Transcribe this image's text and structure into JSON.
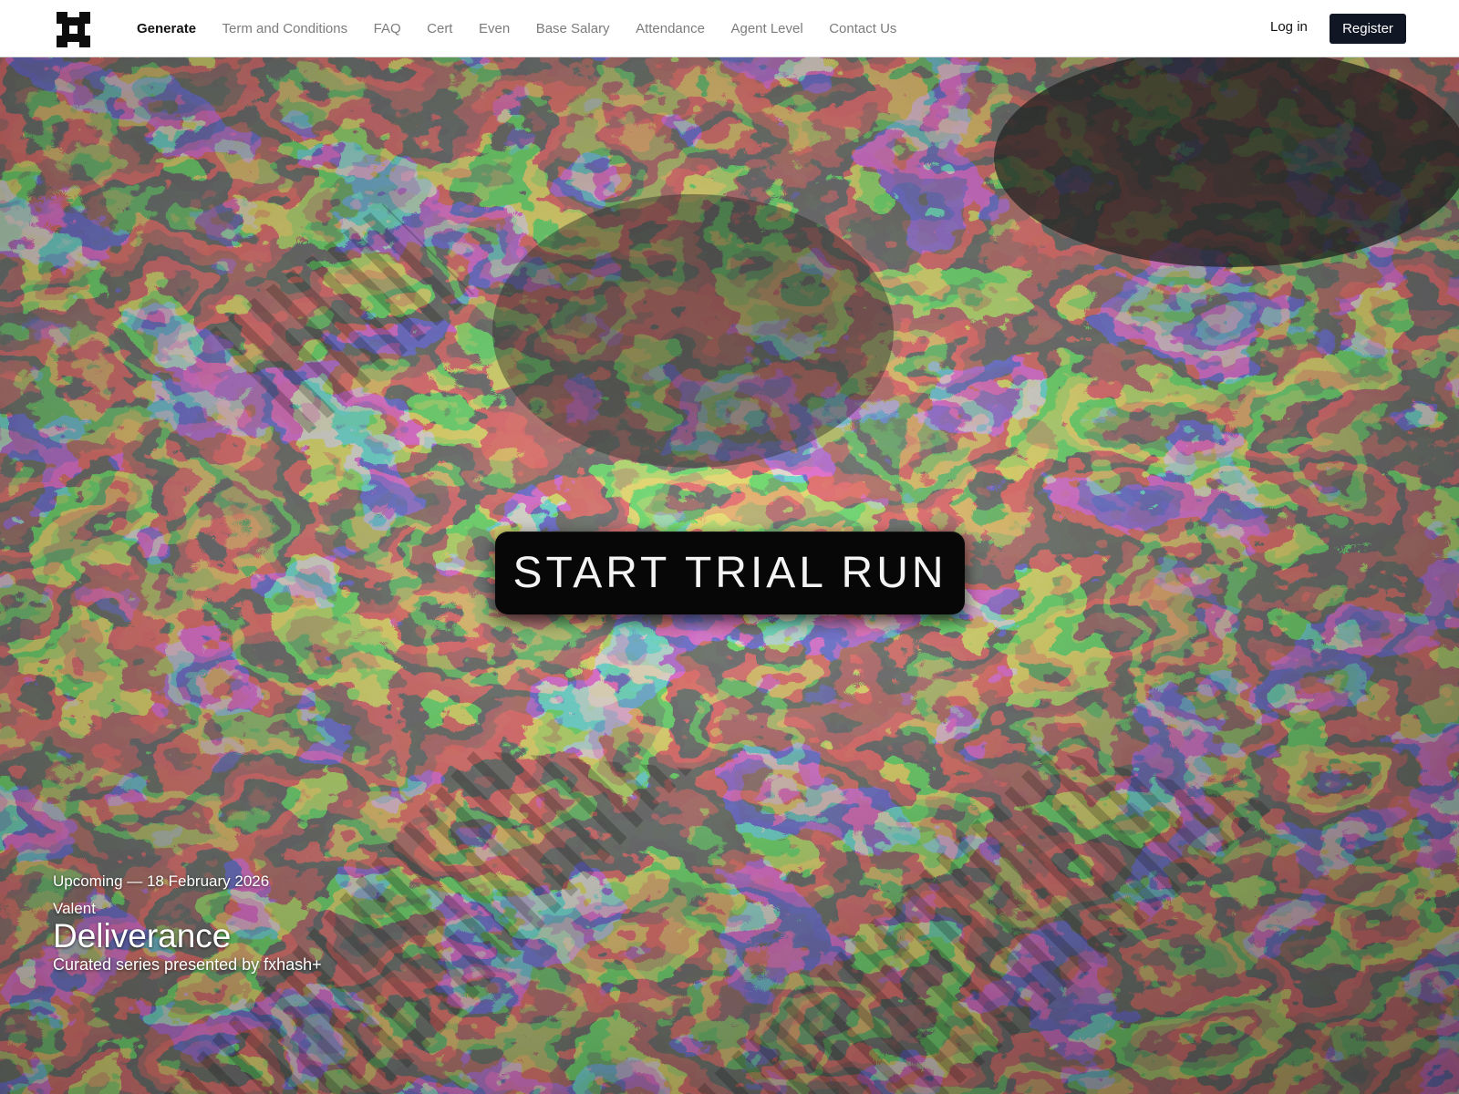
{
  "nav": {
    "logo_icon": "fxhash-logo-icon",
    "links": [
      {
        "label": "Generate",
        "active": true
      },
      {
        "label": "Term and Conditions"
      },
      {
        "label": "FAQ"
      },
      {
        "label": "Cert"
      },
      {
        "label": "Even"
      },
      {
        "label": "Base Salary"
      },
      {
        "label": "Attendance"
      },
      {
        "label": "Agent Level"
      },
      {
        "label": "Contact Us"
      }
    ],
    "login_label": "Log in",
    "register_label": "Register"
  },
  "hero": {
    "cta_label": "START TRIAL RUN",
    "upcoming": "Upcoming — 18 February 2026",
    "artist": "Valent",
    "title": "Deliverance",
    "subtitle": "Curated series presented by fxhash+"
  },
  "colors": {
    "nav_bg": "#ffffff",
    "nav_text": "#7c7c7c",
    "nav_active": "#111111",
    "register_bg": "#101623",
    "cta_bg": "#070707",
    "art_palette": [
      "#2b2c2a",
      "#8a8d7e",
      "#b9b6a4",
      "#4f7185",
      "#7b2f2c",
      "#c84a3e",
      "#c98a2e",
      "#394a34",
      "#5c6b72"
    ]
  }
}
